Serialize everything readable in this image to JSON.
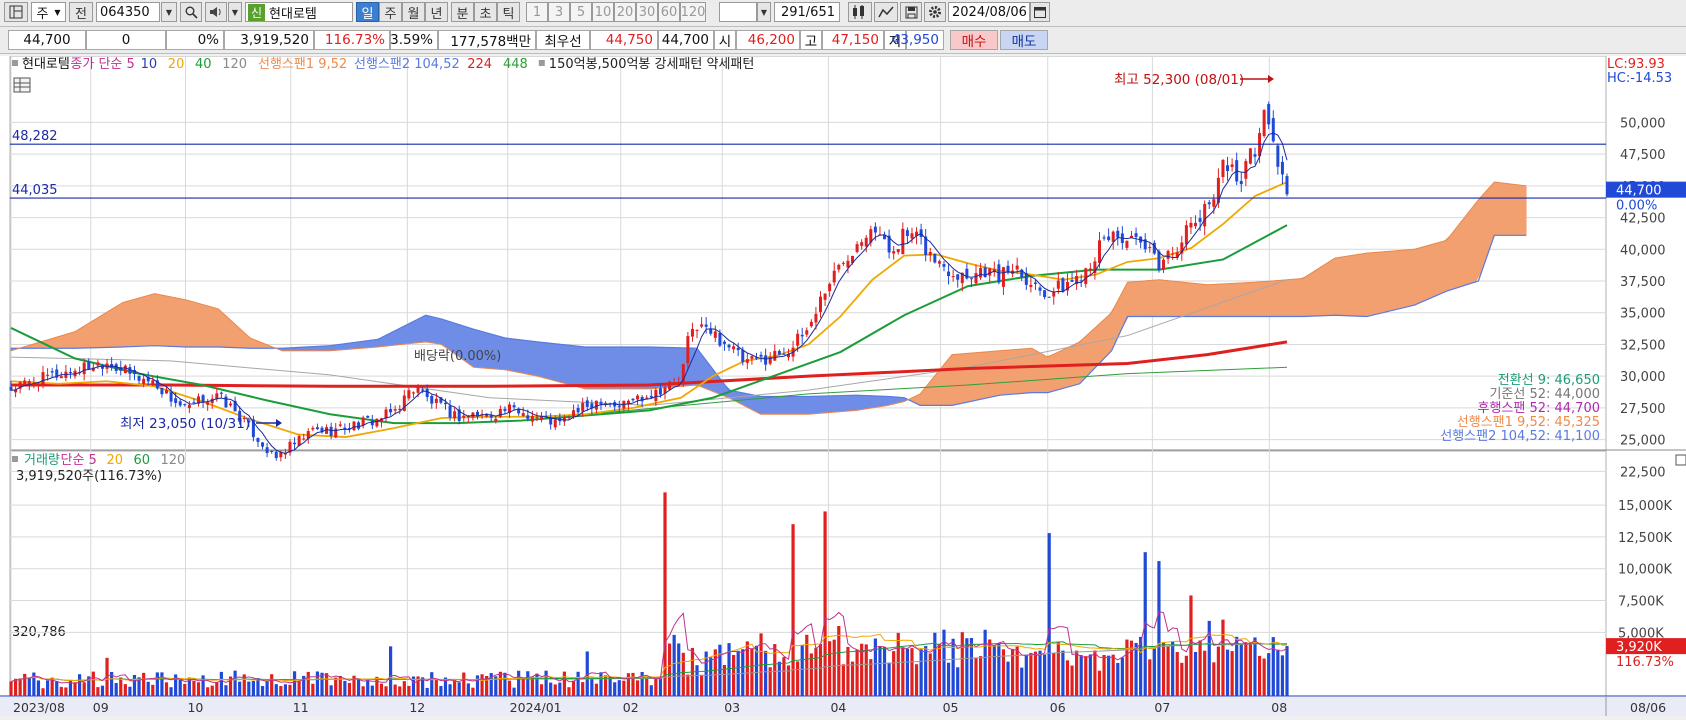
{
  "toolbar": {
    "market_type": "주",
    "prefix_label": "전",
    "stock_code": "064350",
    "stock_badge": "신",
    "stock_name": "현대로템",
    "periods": [
      "일",
      "주",
      "월",
      "년",
      "분",
      "초",
      "틱"
    ],
    "active_period": "일",
    "intervals": [
      "1",
      "3",
      "5",
      "10",
      "20",
      "30",
      "60",
      "120"
    ],
    "count": "291",
    "total": "/651",
    "date": "2024/08/06"
  },
  "quote": {
    "price": "44,700",
    "change": "0",
    "change_pct": "0%",
    "volume": "3,919,520",
    "volume_ratio": "116.73%",
    "turnover": "3.59%",
    "amount": "177,578백만",
    "best_ask_label": "최우선",
    "best_ask": "44,750",
    "best_bid": "44,700",
    "open_label": "시",
    "open": "46,200",
    "high_label": "고",
    "high": "47,150",
    "low_label": "저",
    "low": "43,950",
    "buy_label": "매수",
    "sell_label": "매도"
  },
  "colors": {
    "up": "#e01f1f",
    "down": "#1f49d6",
    "ma5": "#1a2a9a",
    "ma20": "#f0a800",
    "ma40": "#1b9d3a",
    "ma120": "#a7a7a7",
    "ma224": "#e01f1f",
    "ma448": "#2e9f3a",
    "cloud_up": "#f3a070",
    "cloud_dn": "#6f8de6",
    "hline": "#1a2aa8",
    "grid": "#d9d9d9"
  },
  "legend": {
    "items": [
      {
        "text": "현대로템",
        "color": "#111111"
      },
      {
        "text": "종가 단순 5",
        "color": "#c2318f"
      },
      {
        "text": "10",
        "color": "#2a3bb0"
      },
      {
        "text": "20",
        "color": "#f0a800"
      },
      {
        "text": "40",
        "color": "#1b9d3a"
      },
      {
        "text": "120",
        "color": "#8a8a8a"
      },
      {
        "text": "선행스팬1 9,52",
        "color": "#f08a4a"
      },
      {
        "text": "선행스팬2 104,52",
        "color": "#5a7ae0"
      },
      {
        "text": "224",
        "color": "#e01f1f"
      },
      {
        "text": "448",
        "color": "#2e9f3a"
      },
      {
        "text": "150억봉,500억봉 강세패턴  약세패턴",
        "color": "#222222"
      }
    ]
  },
  "price_axis": {
    "ticks": [
      "50,000",
      "47,500",
      "45,000",
      "42,500",
      "40,000",
      "37,500",
      "35,000",
      "32,500",
      "30,000",
      "27,500",
      "25,000",
      "22,500"
    ],
    "lc": "LC:93.93",
    "hc": "HC:-14.53",
    "current": "44,700",
    "current_pct": "0.00%"
  },
  "hlines": [
    {
      "label": "48,282",
      "value": 48282
    },
    {
      "label": "44,035",
      "value": 44035
    }
  ],
  "annotations": {
    "high": "최고 52,300 (08/01)",
    "low": "최저 23,050 (10/31)",
    "dividend": "배당락(0.00%)"
  },
  "ichimoku": [
    {
      "text": "전환선 9: 46,650",
      "color": "#1b9d7a"
    },
    {
      "text": "기준선 52: 44,000",
      "color": "#777777"
    },
    {
      "text": "후행스팬 52: 44,700",
      "color": "#b02ab0"
    },
    {
      "text": "선행스팬1 9,52: 45,325",
      "color": "#f08a4a"
    },
    {
      "text": "선행스팬2 104,52: 41,100",
      "color": "#5a7ae0"
    }
  ],
  "volume_legend": {
    "items": [
      {
        "text": "거래량",
        "color": "#1b9d7a"
      },
      {
        "text": "단순 5",
        "color": "#c2318f"
      },
      {
        "text": "20",
        "color": "#f0a800"
      },
      {
        "text": "60",
        "color": "#1b9d3a"
      },
      {
        "text": "120",
        "color": "#8a8a8a"
      }
    ],
    "summary": "3,919,520주(116.73%)",
    "left_value": "320,786"
  },
  "volume_axis": {
    "ticks": [
      "15,000K",
      "12,500K",
      "10,000K",
      "7,500K",
      "5,000K"
    ],
    "current": "3,920K",
    "current_pct": "116.73%"
  },
  "x_axis": {
    "labels": [
      "2023/08",
      "09",
      "10",
      "11",
      "12",
      "2024/01",
      "02",
      "03",
      "04",
      "05",
      "06",
      "07",
      "08"
    ],
    "end_label": "08/06"
  },
  "chart_data": {
    "type": "candlestick",
    "price_range": [
      21500,
      53500
    ],
    "volume_range_k": [
      0,
      16500
    ],
    "months": [
      {
        "label": "2023/08",
        "x": 0
      },
      {
        "label": "09",
        "x": 0.05
      },
      {
        "label": "10",
        "x": 0.1094
      },
      {
        "label": "11",
        "x": 0.1754
      },
      {
        "label": "12",
        "x": 0.2485
      },
      {
        "label": "2024/01",
        "x": 0.3114
      },
      {
        "label": "02",
        "x": 0.3823
      },
      {
        "label": "03",
        "x": 0.4459
      },
      {
        "label": "04",
        "x": 0.5125
      },
      {
        "label": "05",
        "x": 0.5828
      },
      {
        "label": "06",
        "x": 0.65
      },
      {
        "label": "07",
        "x": 0.7156
      },
      {
        "label": "08",
        "x": 0.7889
      }
    ],
    "close_path": [
      [
        0.0,
        29000
      ],
      [
        0.02,
        29800
      ],
      [
        0.04,
        30500
      ],
      [
        0.06,
        31200
      ],
      [
        0.075,
        30100
      ],
      [
        0.09,
        29500
      ],
      [
        0.1,
        28300
      ],
      [
        0.11,
        27300
      ],
      [
        0.12,
        28200
      ],
      [
        0.13,
        28400
      ],
      [
        0.14,
        27300
      ],
      [
        0.15,
        25800
      ],
      [
        0.16,
        24300
      ],
      [
        0.165,
        23400
      ],
      [
        0.172,
        24200
      ],
      [
        0.18,
        24800
      ],
      [
        0.19,
        25800
      ],
      [
        0.2,
        25700
      ],
      [
        0.21,
        26000
      ],
      [
        0.22,
        26300
      ],
      [
        0.23,
        26600
      ],
      [
        0.24,
        27200
      ],
      [
        0.25,
        28800
      ],
      [
        0.255,
        29300
      ],
      [
        0.26,
        28300
      ],
      [
        0.27,
        27500
      ],
      [
        0.28,
        26800
      ],
      [
        0.29,
        27000
      ],
      [
        0.3,
        26900
      ],
      [
        0.31,
        27400
      ],
      [
        0.32,
        27200
      ],
      [
        0.33,
        26800
      ],
      [
        0.345,
        26200
      ],
      [
        0.35,
        27000
      ],
      [
        0.36,
        27500
      ],
      [
        0.37,
        28300
      ],
      [
        0.38,
        27600
      ],
      [
        0.39,
        28200
      ],
      [
        0.4,
        28600
      ],
      [
        0.41,
        29200
      ],
      [
        0.42,
        29600
      ],
      [
        0.425,
        33200
      ],
      [
        0.43,
        34100
      ],
      [
        0.44,
        33300
      ],
      [
        0.45,
        32500
      ],
      [
        0.46,
        31000
      ],
      [
        0.47,
        31300
      ],
      [
        0.48,
        31800
      ],
      [
        0.49,
        32300
      ],
      [
        0.5,
        33800
      ],
      [
        0.51,
        36800
      ],
      [
        0.52,
        38800
      ],
      [
        0.53,
        40600
      ],
      [
        0.54,
        42200
      ],
      [
        0.55,
        39800
      ],
      [
        0.56,
        41200
      ],
      [
        0.57,
        40600
      ],
      [
        0.58,
        39000
      ],
      [
        0.59,
        38300
      ],
      [
        0.6,
        38000
      ],
      [
        0.61,
        38500
      ],
      [
        0.62,
        37800
      ],
      [
        0.63,
        38900
      ],
      [
        0.64,
        37300
      ],
      [
        0.65,
        36600
      ],
      [
        0.66,
        37100
      ],
      [
        0.67,
        37900
      ],
      [
        0.68,
        39700
      ],
      [
        0.69,
        41300
      ],
      [
        0.7,
        40700
      ],
      [
        0.71,
        40100
      ],
      [
        0.72,
        38800
      ],
      [
        0.73,
        40200
      ],
      [
        0.74,
        41800
      ],
      [
        0.75,
        43100
      ],
      [
        0.76,
        47000
      ],
      [
        0.77,
        45500
      ],
      [
        0.78,
        48000
      ],
      [
        0.785,
        50700
      ],
      [
        0.79,
        49300
      ],
      [
        0.795,
        46500
      ],
      [
        0.8,
        44700
      ]
    ],
    "ma20_path": [
      [
        0.0,
        29600
      ],
      [
        0.03,
        29400
      ],
      [
        0.06,
        29600
      ],
      [
        0.09,
        29200
      ],
      [
        0.12,
        28000
      ],
      [
        0.15,
        26600
      ],
      [
        0.18,
        25400
      ],
      [
        0.21,
        25200
      ],
      [
        0.24,
        25900
      ],
      [
        0.27,
        26700
      ],
      [
        0.3,
        26800
      ],
      [
        0.33,
        26800
      ],
      [
        0.36,
        27000
      ],
      [
        0.39,
        27500
      ],
      [
        0.42,
        28300
      ],
      [
        0.44,
        30000
      ],
      [
        0.46,
        31200
      ],
      [
        0.48,
        31600
      ],
      [
        0.5,
        32500
      ],
      [
        0.52,
        34700
      ],
      [
        0.54,
        37600
      ],
      [
        0.56,
        39500
      ],
      [
        0.58,
        39600
      ],
      [
        0.6,
        38900
      ],
      [
        0.62,
        38300
      ],
      [
        0.64,
        38000
      ],
      [
        0.66,
        37600
      ],
      [
        0.68,
        38000
      ],
      [
        0.7,
        39000
      ],
      [
        0.72,
        39300
      ],
      [
        0.74,
        40100
      ],
      [
        0.76,
        42000
      ],
      [
        0.78,
        44200
      ],
      [
        0.8,
        45300
      ]
    ],
    "ma40_path": [
      [
        0.0,
        33800
      ],
      [
        0.04,
        31400
      ],
      [
        0.08,
        30200
      ],
      [
        0.12,
        29300
      ],
      [
        0.16,
        28100
      ],
      [
        0.2,
        27000
      ],
      [
        0.24,
        26300
      ],
      [
        0.28,
        26300
      ],
      [
        0.32,
        26500
      ],
      [
        0.36,
        26900
      ],
      [
        0.4,
        27300
      ],
      [
        0.44,
        28300
      ],
      [
        0.48,
        30100
      ],
      [
        0.52,
        31900
      ],
      [
        0.56,
        34800
      ],
      [
        0.6,
        37100
      ],
      [
        0.64,
        37900
      ],
      [
        0.68,
        38400
      ],
      [
        0.72,
        38400
      ],
      [
        0.76,
        39200
      ],
      [
        0.8,
        41900
      ]
    ],
    "ma224_path": [
      [
        0.0,
        29300
      ],
      [
        0.1,
        29300
      ],
      [
        0.2,
        29200
      ],
      [
        0.3,
        29200
      ],
      [
        0.4,
        29300
      ],
      [
        0.5,
        30000
      ],
      [
        0.6,
        30600
      ],
      [
        0.7,
        31000
      ],
      [
        0.75,
        31700
      ],
      [
        0.8,
        32700
      ]
    ],
    "ma120_path": [
      [
        0.0,
        31500
      ],
      [
        0.1,
        31200
      ],
      [
        0.2,
        30100
      ],
      [
        0.3,
        28300
      ],
      [
        0.4,
        27700
      ],
      [
        0.5,
        28900
      ],
      [
        0.6,
        30700
      ],
      [
        0.7,
        33200
      ],
      [
        0.8,
        37600
      ]
    ],
    "ma448_path": [
      [
        0.37,
        27100
      ],
      [
        0.5,
        28600
      ],
      [
        0.6,
        29300
      ],
      [
        0.7,
        30200
      ],
      [
        0.8,
        30700
      ]
    ],
    "span1": [
      [
        0.0,
        32000
      ],
      [
        0.04,
        33500
      ],
      [
        0.07,
        35800
      ],
      [
        0.09,
        36500
      ],
      [
        0.11,
        36000
      ],
      [
        0.13,
        35300
      ],
      [
        0.15,
        33000
      ],
      [
        0.17,
        32000
      ],
      [
        0.2,
        32000
      ],
      [
        0.23,
        32300
      ],
      [
        0.26,
        32700
      ],
      [
        0.27,
        32500
      ],
      [
        0.29,
        30700
      ],
      [
        0.31,
        30500
      ],
      [
        0.33,
        30000
      ],
      [
        0.36,
        29000
      ],
      [
        0.4,
        29000
      ],
      [
        0.43,
        29300
      ],
      [
        0.45,
        28300
      ],
      [
        0.47,
        27000
      ],
      [
        0.5,
        27000
      ],
      [
        0.53,
        27300
      ],
      [
        0.55,
        27700
      ],
      [
        0.56,
        28000
      ],
      [
        0.57,
        28600
      ],
      [
        0.59,
        31700
      ],
      [
        0.62,
        32000
      ],
      [
        0.64,
        32200
      ],
      [
        0.65,
        31500
      ],
      [
        0.67,
        32700
      ],
      [
        0.69,
        35000
      ],
      [
        0.7,
        37400
      ],
      [
        0.72,
        37600
      ],
      [
        0.75,
        37200
      ],
      [
        0.78,
        37400
      ],
      [
        0.81,
        37700
      ],
      [
        0.83,
        39300
      ],
      [
        0.85,
        39700
      ],
      [
        0.88,
        40000
      ],
      [
        0.9,
        40700
      ],
      [
        0.92,
        43900
      ],
      [
        0.93,
        45300
      ],
      [
        0.95,
        45000
      ]
    ],
    "span2": [
      [
        0.0,
        32200
      ],
      [
        0.04,
        32200
      ],
      [
        0.07,
        32300
      ],
      [
        0.09,
        32400
      ],
      [
        0.11,
        32300
      ],
      [
        0.13,
        32300
      ],
      [
        0.15,
        32200
      ],
      [
        0.17,
        32200
      ],
      [
        0.2,
        32400
      ],
      [
        0.23,
        32900
      ],
      [
        0.26,
        34800
      ],
      [
        0.27,
        34500
      ],
      [
        0.29,
        33700
      ],
      [
        0.31,
        33000
      ],
      [
        0.33,
        32700
      ],
      [
        0.36,
        32300
      ],
      [
        0.4,
        32300
      ],
      [
        0.43,
        32200
      ],
      [
        0.45,
        28900
      ],
      [
        0.47,
        28400
      ],
      [
        0.5,
        28400
      ],
      [
        0.53,
        28500
      ],
      [
        0.55,
        28400
      ],
      [
        0.56,
        28300
      ],
      [
        0.57,
        27700
      ],
      [
        0.59,
        27700
      ],
      [
        0.62,
        28500
      ],
      [
        0.64,
        28700
      ],
      [
        0.65,
        28700
      ],
      [
        0.67,
        29400
      ],
      [
        0.69,
        32000
      ],
      [
        0.7,
        34700
      ],
      [
        0.72,
        34700
      ],
      [
        0.75,
        34700
      ],
      [
        0.78,
        34700
      ],
      [
        0.81,
        34700
      ],
      [
        0.83,
        34800
      ],
      [
        0.85,
        34700
      ],
      [
        0.88,
        35600
      ],
      [
        0.9,
        36700
      ],
      [
        0.92,
        37500
      ],
      [
        0.93,
        41100
      ],
      [
        0.95,
        41100
      ]
    ],
    "volume_spikes_k": [
      [
        0.06,
        3000
      ],
      [
        0.16,
        1200
      ],
      [
        0.238,
        3900
      ],
      [
        0.36,
        3500
      ],
      [
        0.41,
        16000
      ],
      [
        0.417,
        4800
      ],
      [
        0.49,
        13500
      ],
      [
        0.51,
        14500
      ],
      [
        0.52,
        5500
      ],
      [
        0.65,
        12800
      ],
      [
        0.71,
        11300
      ],
      [
        0.72,
        10600
      ],
      [
        0.74,
        7900
      ],
      [
        0.75,
        5900
      ],
      [
        0.76,
        6000
      ],
      [
        0.78,
        4600
      ],
      [
        0.8,
        3920
      ]
    ]
  }
}
